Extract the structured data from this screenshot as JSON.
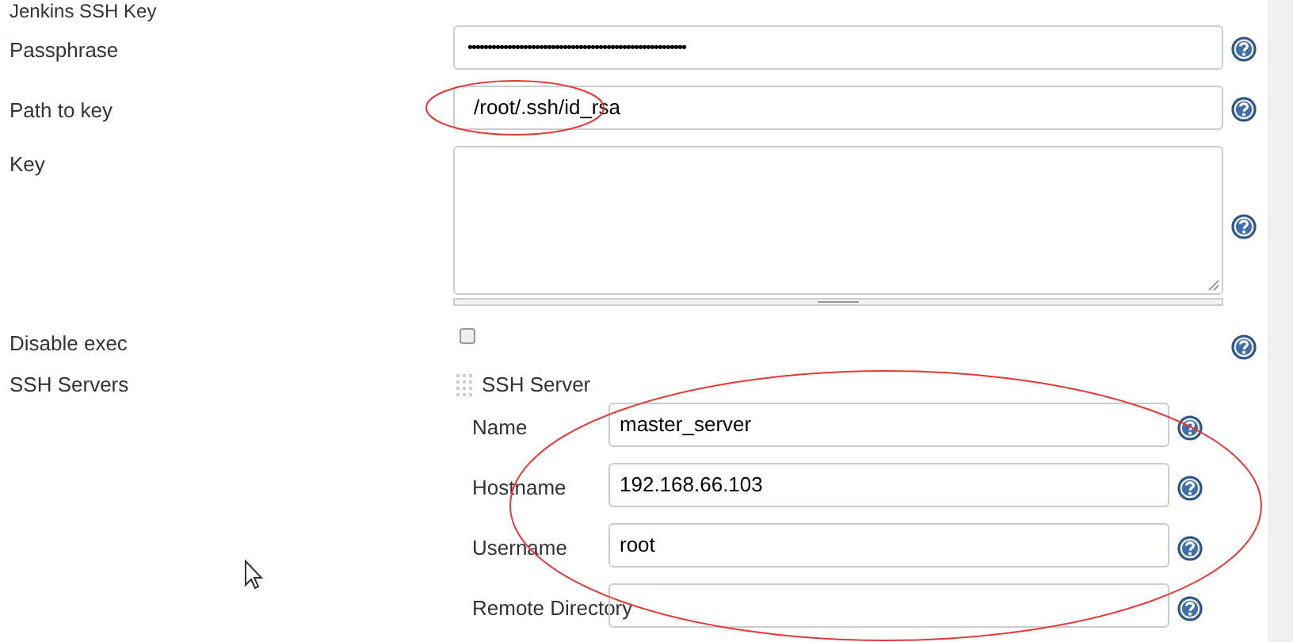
{
  "section_title": "Jenkins SSH Key",
  "fields": [
    {
      "kind": "password",
      "label": "Passphrase",
      "value": "•••••••••••••••••••••••••••••••••••••••••••••••••••••••"
    },
    {
      "kind": "text",
      "label": "Path to key",
      "value": "/root/.ssh/id_rsa"
    },
    {
      "kind": "textarea",
      "label": "Key"
    },
    {
      "kind": "checkbox",
      "label": "Disable exec",
      "checked": false
    }
  ],
  "ssh_servers": {
    "label": "SSH Servers",
    "server_title": "SSH Server",
    "fields": [
      {
        "label": "Name",
        "value": "master_server"
      },
      {
        "label": "Hostname",
        "value": "192.168.66.103"
      },
      {
        "label": "Username",
        "value": "root"
      },
      {
        "label": "Remote Directory"
      }
    ]
  }
}
